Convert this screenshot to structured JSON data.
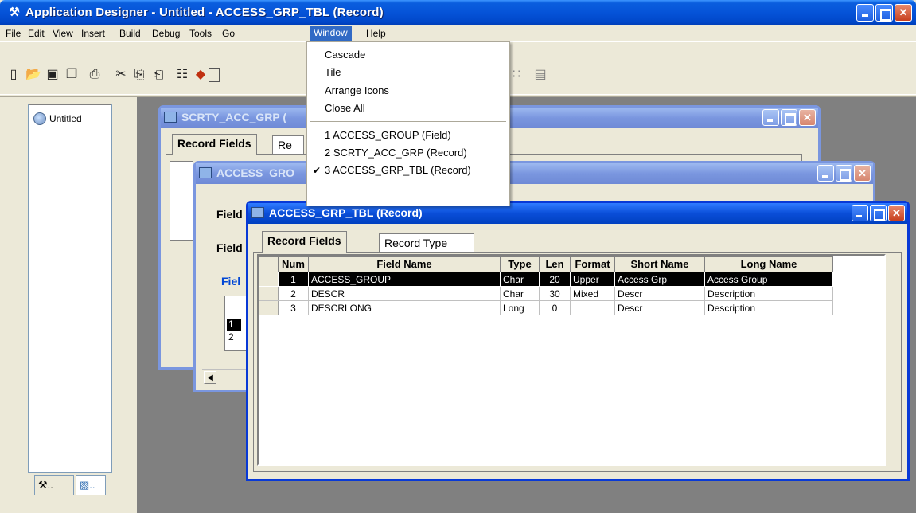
{
  "window": {
    "title": "Application Designer - Untitled - ACCESS_GRP_TBL (Record)",
    "app_icon": "tools-icon"
  },
  "menubar": {
    "items": [
      "File",
      "Edit",
      "View",
      "Insert",
      "Build",
      "Debug",
      "Tools",
      "Go",
      "Window",
      "Help"
    ],
    "active": "Window"
  },
  "window_menu": {
    "items": [
      "Cascade",
      "Tile",
      "Arrange Icons",
      "Close All"
    ],
    "windows": [
      "1 ACCESS_GROUP (Field)",
      "2 SCRTY_ACC_GRP (Record)",
      "3 ACCESS_GRP_TBL (Record)"
    ],
    "checked_index": 2
  },
  "project": {
    "root": "Untitled",
    "tab_icons": [
      "tools-icon",
      "blocks-icon"
    ]
  },
  "windows": {
    "back": {
      "title": "SCRTY_ACC_GRP (",
      "tab_selected": "Record Fields",
      "tab_partial": "Re",
      "row_nums": [
        "1",
        "2"
      ]
    },
    "middle": {
      "title": "ACCESS_GRO",
      "label1": "Field",
      "label2": "Field",
      "label3": "Fiel"
    },
    "front": {
      "title": "ACCESS_GRP_TBL (Record)",
      "tabs": [
        "Record Fields",
        "Record Type"
      ],
      "columns": [
        "Num",
        "Field Name",
        "Type",
        "Len",
        "Format",
        "Short Name",
        "Long Name"
      ],
      "rows": [
        {
          "num": "1",
          "field": "ACCESS_GROUP",
          "type": "Char",
          "len": "20",
          "format": "Upper",
          "short": "Access Grp",
          "long": "Access Group"
        },
        {
          "num": "2",
          "field": "DESCR",
          "type": "Char",
          "len": "30",
          "format": "Mixed",
          "short": "Descr",
          "long": "Description"
        },
        {
          "num": "3",
          "field": "DESCRLONG",
          "type": "Long",
          "len": "0",
          "format": "",
          "short": "Descr",
          "long": "Description"
        }
      ],
      "selected_row": 0
    }
  },
  "colors": {
    "titlebar": "#0553d8",
    "mdi_bg": "#808080",
    "menu_highlight": "#316ac5",
    "selected_row": "#000000"
  }
}
